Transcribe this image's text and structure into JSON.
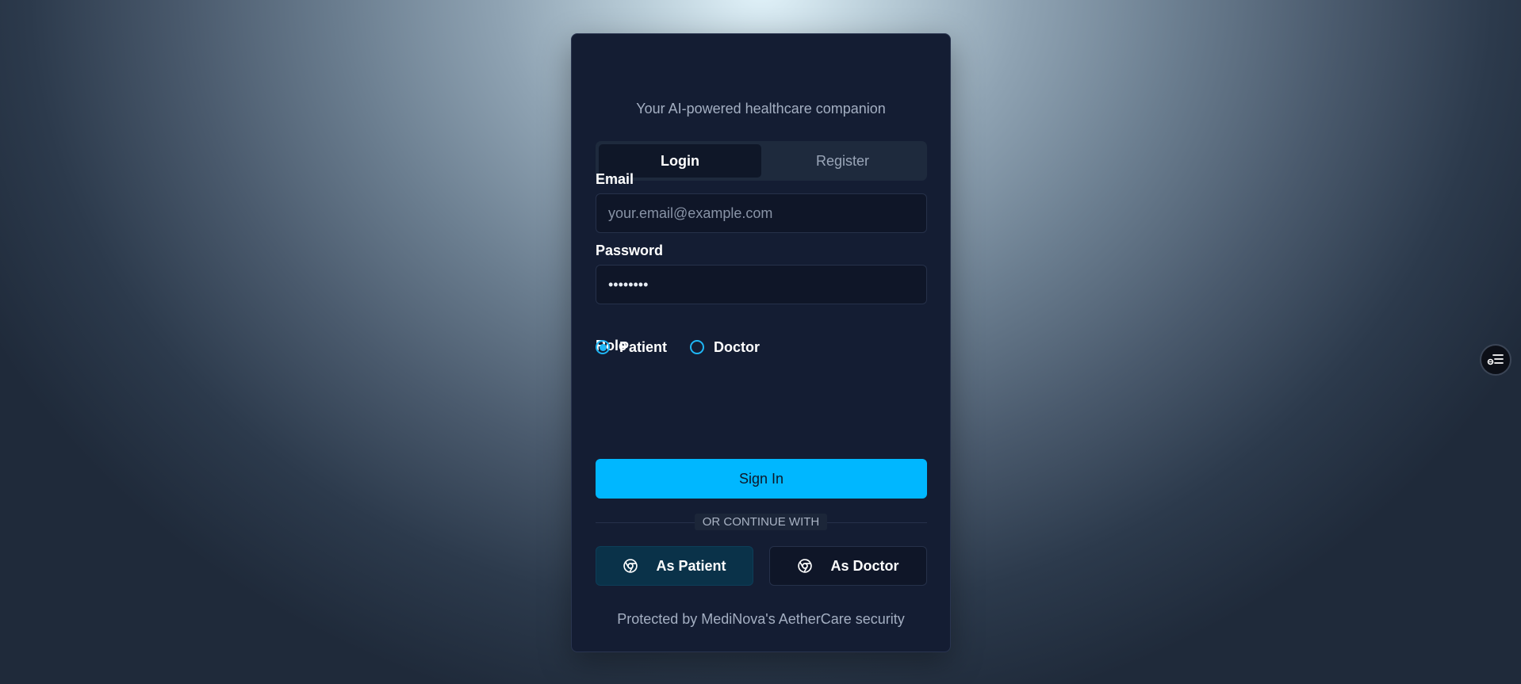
{
  "subtitle": "Your AI-powered healthcare companion",
  "tabs": [
    {
      "label": "Login",
      "active": true
    },
    {
      "label": "Register",
      "active": false
    }
  ],
  "email": {
    "label": "Email",
    "placeholder": "your.email@example.com",
    "value": ""
  },
  "password": {
    "label": "Password",
    "value": "12345678"
  },
  "role": {
    "label": "Role",
    "options": [
      "Patient",
      "Doctor"
    ],
    "selected": "Patient"
  },
  "signin_label": "Sign In",
  "divider_text": "OR CONTINUE WITH",
  "social": {
    "patient_label": "As Patient",
    "doctor_label": "As Doctor",
    "icon": "chrome-icon"
  },
  "footer": "Protected by MediNova's AetherCare security",
  "floating_button_icon": "accessibility-settings-icon",
  "colors": {
    "accent": "#00b7ff",
    "card_bg": "#141d33",
    "input_bg": "#0f1628",
    "patient_button_bg": "#0a3249"
  }
}
